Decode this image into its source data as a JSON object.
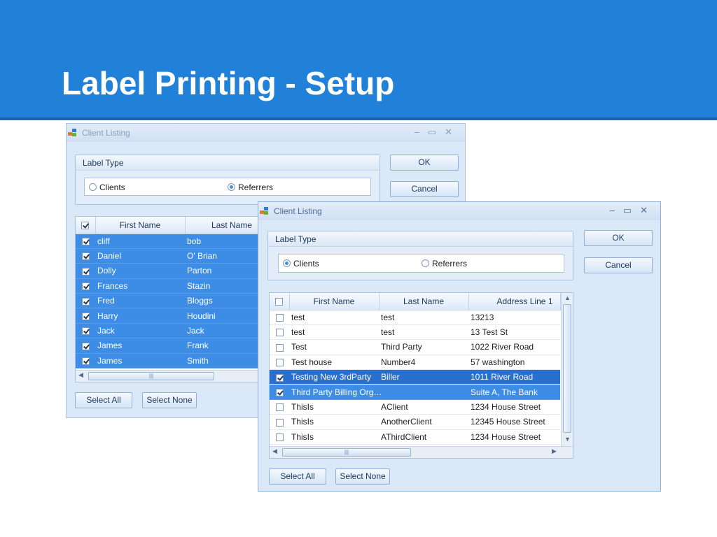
{
  "slide": {
    "title": "Label Printing - Setup"
  },
  "colors": {
    "header": "#2181d8",
    "selection": "#3d8de6",
    "selection_dark": "#2a6fcb"
  },
  "back_window": {
    "title": "Client Listing",
    "label_type": "Label Type",
    "radio_clients": "Clients",
    "radio_referrers": "Referrers",
    "selected_radio": "referrers",
    "ok_label": "OK",
    "cancel_label": "Cancel",
    "columns": [
      "First Name",
      "Last Name"
    ],
    "rows": [
      [
        "cliff",
        "bob"
      ],
      [
        "Daniel",
        "O' Brian"
      ],
      [
        "Dolly",
        "Parton"
      ],
      [
        "Frances",
        "Stazin"
      ],
      [
        "Fred",
        "Bloggs"
      ],
      [
        "Harry",
        "Houdini"
      ],
      [
        "Jack",
        "Jack"
      ],
      [
        "James",
        "Frank"
      ],
      [
        "James",
        "Smith"
      ]
    ],
    "select_all_label": "Select All",
    "select_none_label": "Select None"
  },
  "front_window": {
    "title": "Client Listing",
    "label_type": "Label Type",
    "radio_clients": "Clients",
    "radio_referrers": "Referrers",
    "selected_radio": "clients",
    "ok_label": "OK",
    "cancel_label": "Cancel",
    "columns": [
      "First Name",
      "Last Name",
      "Address Line 1"
    ],
    "rows": [
      {
        "checked": false,
        "first": "test",
        "last": "test",
        "address": "13213",
        "state": "normal"
      },
      {
        "checked": false,
        "first": "test",
        "last": "test",
        "address": "13 Test St",
        "state": "normal"
      },
      {
        "checked": false,
        "first": "Test",
        "last": "Third Party",
        "address": "1022 River Road",
        "state": "normal"
      },
      {
        "checked": false,
        "first": "Test house",
        "last": "Number4",
        "address": "57 washington",
        "state": "normal"
      },
      {
        "checked": true,
        "first": "Testing New 3rdParty",
        "last": "Biller",
        "address": "1011 River Road",
        "state": "selected-dark"
      },
      {
        "checked": true,
        "first": "Third Party Billing Org…",
        "last": "",
        "address": "Suite A, The Bank",
        "state": "selected"
      },
      {
        "checked": false,
        "first": "ThisIs",
        "last": "AClient",
        "address": "1234 House Street",
        "state": "normal"
      },
      {
        "checked": false,
        "first": "ThisIs",
        "last": "AnotherClient",
        "address": "12345 House Street",
        "state": "normal"
      },
      {
        "checked": false,
        "first": "ThisIs",
        "last": "AThirdClient",
        "address": "1234 House Street",
        "state": "normal"
      }
    ],
    "select_all_label": "Select All",
    "select_none_label": "Select None"
  }
}
